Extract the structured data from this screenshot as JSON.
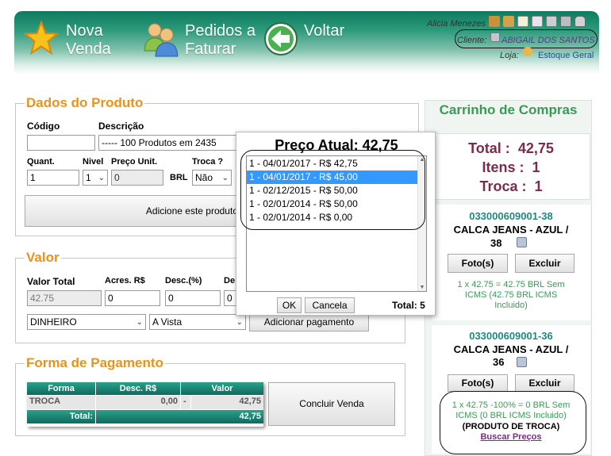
{
  "header": {
    "nova_venda": [
      "Nova",
      "Venda"
    ],
    "pedidos": [
      "Pedidos a",
      "Faturar"
    ],
    "voltar": "Voltar",
    "user": "Alicia Menezes",
    "cliente_label": "Cliente:",
    "cliente_value": "ABIGAIL DOS SANTOS",
    "loja_label": "Loja:",
    "loja_value": "Estoque Geral"
  },
  "produto": {
    "legend": "Dados do Produto",
    "codigo_label": "Código",
    "codigo_value": "",
    "descricao_label": "Descrição",
    "descricao_value": "----- 100 Produtos em 2435",
    "quant_label": "Quant.",
    "quant_value": "1",
    "nivel_label": "Nivel",
    "nivel_value": "1",
    "preco_label": "Preço Unit.",
    "preco_value": "0",
    "moeda": "BRL",
    "troca_label": "Troca ?",
    "troca_value": "Não",
    "add_button": "Adicione este produto"
  },
  "valor": {
    "legend": "Valor",
    "total_label": "Valor Total",
    "total_value": "42.75",
    "acres_label": "Acres. R$",
    "acres_value": "0",
    "desc_pct_label": "Desc.(%)",
    "desc_pct_value": "0",
    "de_label": "De",
    "de_value": "0",
    "tipo_value": "DINHEIRO",
    "prazo_value": "A Vista",
    "add_pag_button": "Adicionar pagamento"
  },
  "pagamento": {
    "legend": "Forma de Pagamento",
    "headers": [
      "Forma",
      "Desc. R$",
      "Valor"
    ],
    "row": {
      "forma": "TROCA",
      "desc": "0,00",
      "sep": "-",
      "valor": "42,75"
    },
    "total_label": "Total:",
    "total_value": "42,75",
    "concluir_button": "Concluir Venda"
  },
  "cart": {
    "title": "Carrinho de Compras",
    "total_label": "Total :",
    "total_value": "42,75",
    "itens_label": "Itens :",
    "itens_value": "1",
    "troca_label": "Troca :",
    "troca_value": "1",
    "items": [
      {
        "code": "033000609001-38",
        "name": "CALCA JEANS - AZUL /",
        "size": "38",
        "foto": "Foto(s)",
        "excluir": "Excluir",
        "desc": [
          "1 x 42.75 = 42.75 BRL Sem",
          "ICMS (42.75 BRL ICMS",
          "Incluido)"
        ]
      },
      {
        "code": "033000609001-36",
        "name": "CALCA JEANS - AZUL /",
        "size": "36",
        "foto": "Foto(s)",
        "excluir": "Excluir",
        "desc": [
          "1 x 42.75 -100% = 0 BRL Sem",
          "ICMS (0 BRL ICMS Incluido)"
        ],
        "troca": "(PRODUTO DE TROCA)",
        "link": "Buscar Preços"
      }
    ]
  },
  "popup": {
    "title": "Preço Atual: 42,75",
    "items": [
      "1 - 04/01/2017 - R$ 42,75",
      "1 - 04/01/2017 - R$ 45,00",
      "1 - 02/12/2015 - R$ 50,00",
      "1 - 02/01/2014 - R$ 50,00",
      "1 - 02/01/2014 - R$ 0,00"
    ],
    "ok": "OK",
    "cancela": "Cancela",
    "total": "Total: 5"
  },
  "colors": {
    "header": "#0f7a5f",
    "legend": "#e8931d",
    "cart_title": "#3a9a55",
    "totals": "#7a2c4f",
    "code": "#1f8a80",
    "selected": "#3399ff"
  }
}
